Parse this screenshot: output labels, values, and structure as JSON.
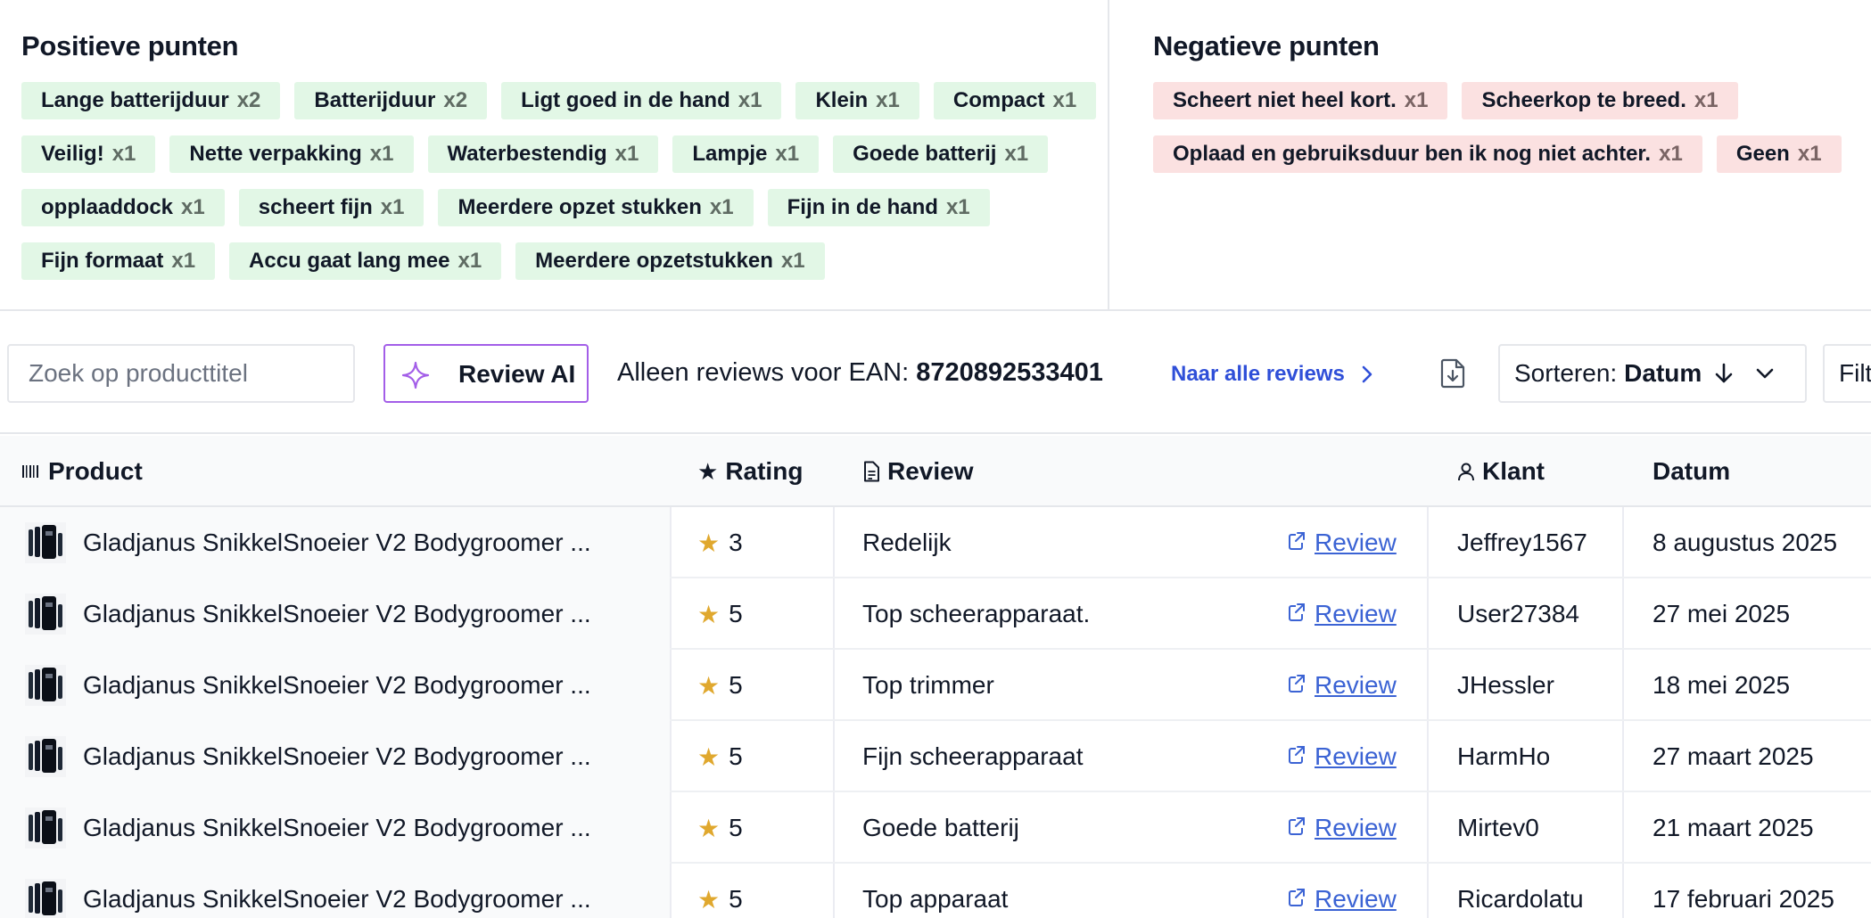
{
  "positive": {
    "title": "Positieve punten",
    "chips": [
      {
        "label": "Lange batterijduur",
        "count": "x2"
      },
      {
        "label": "Batterijduur",
        "count": "x2"
      },
      {
        "label": "Ligt goed in de hand",
        "count": "x1"
      },
      {
        "label": "Klein",
        "count": "x1"
      },
      {
        "label": "Compact",
        "count": "x1"
      },
      {
        "label": "Veilig!",
        "count": "x1"
      },
      {
        "label": "Nette verpakking",
        "count": "x1"
      },
      {
        "label": "Waterbestendig",
        "count": "x1"
      },
      {
        "label": "Lampje",
        "count": "x1"
      },
      {
        "label": "Goede batterij",
        "count": "x1"
      },
      {
        "label": "opplaaddock",
        "count": "x1"
      },
      {
        "label": "scheert fijn",
        "count": "x1"
      },
      {
        "label": "Meerdere opzet stukken",
        "count": "x1"
      },
      {
        "label": "Fijn in de hand",
        "count": "x1"
      },
      {
        "label": "Fijn formaat",
        "count": "x1"
      },
      {
        "label": "Accu gaat lang mee",
        "count": "x1"
      },
      {
        "label": "Meerdere opzetstukken",
        "count": "x1"
      }
    ]
  },
  "negative": {
    "title": "Negatieve punten",
    "chips": [
      {
        "label": "Scheert niet heel kort.",
        "count": "x1"
      },
      {
        "label": "Scheerkop te breed.",
        "count": "x1"
      },
      {
        "label": "Oplaad en gebruiksduur ben ik nog niet achter.",
        "count": "x1"
      },
      {
        "label": "Geen",
        "count": "x1"
      }
    ]
  },
  "toolbar": {
    "search_placeholder": "Zoek op producttitel",
    "ai_label": "Review AI",
    "ean_prefix": "Alleen reviews voor EAN:",
    "ean": "8720892533401",
    "all_reviews_link": "Naar alle reviews",
    "sort_prefix": "Sorteren:",
    "sort_value": "Datum",
    "filter_label": "Filt"
  },
  "table": {
    "headers": {
      "product": "Product",
      "rating": "Rating",
      "review": "Review",
      "klant": "Klant",
      "datum": "Datum"
    },
    "rows": [
      {
        "title": "Gladjanus SnikkelSnoeier V2 Bodygroomer ...",
        "rating": "3",
        "review": "Redelijk",
        "link": "Review",
        "klant": "Jeffrey1567",
        "datum": "8 augustus 2025"
      },
      {
        "title": "Gladjanus SnikkelSnoeier V2 Bodygroomer ...",
        "rating": "5",
        "review": "Top scheerapparaat.",
        "link": "Review",
        "klant": "User27384",
        "datum": "27 mei 2025"
      },
      {
        "title": "Gladjanus SnikkelSnoeier V2 Bodygroomer ...",
        "rating": "5",
        "review": "Top trimmer",
        "link": "Review",
        "klant": "JHessler",
        "datum": "18 mei 2025"
      },
      {
        "title": "Gladjanus SnikkelSnoeier V2 Bodygroomer ...",
        "rating": "5",
        "review": "Fijn scheerapparaat",
        "link": "Review",
        "klant": "HarmHo",
        "datum": "27 maart 2025"
      },
      {
        "title": "Gladjanus SnikkelSnoeier V2 Bodygroomer ...",
        "rating": "5",
        "review": "Goede batterij",
        "link": "Review",
        "klant": "Mirtev0",
        "datum": "21 maart 2025"
      },
      {
        "title": "Gladjanus SnikkelSnoeier V2 Bodygroomer ...",
        "rating": "5",
        "review": "Top apparaat",
        "link": "Review",
        "klant": "Ricardolatu",
        "datum": "17 februari 2025"
      }
    ]
  },
  "colors": {
    "positive_chip_bg": "#e2f7e6",
    "negative_chip_bg": "#fbe1e1",
    "ai_accent": "#a35ee8",
    "link_blue": "#2f4fd8",
    "star": "#e0a82e"
  }
}
